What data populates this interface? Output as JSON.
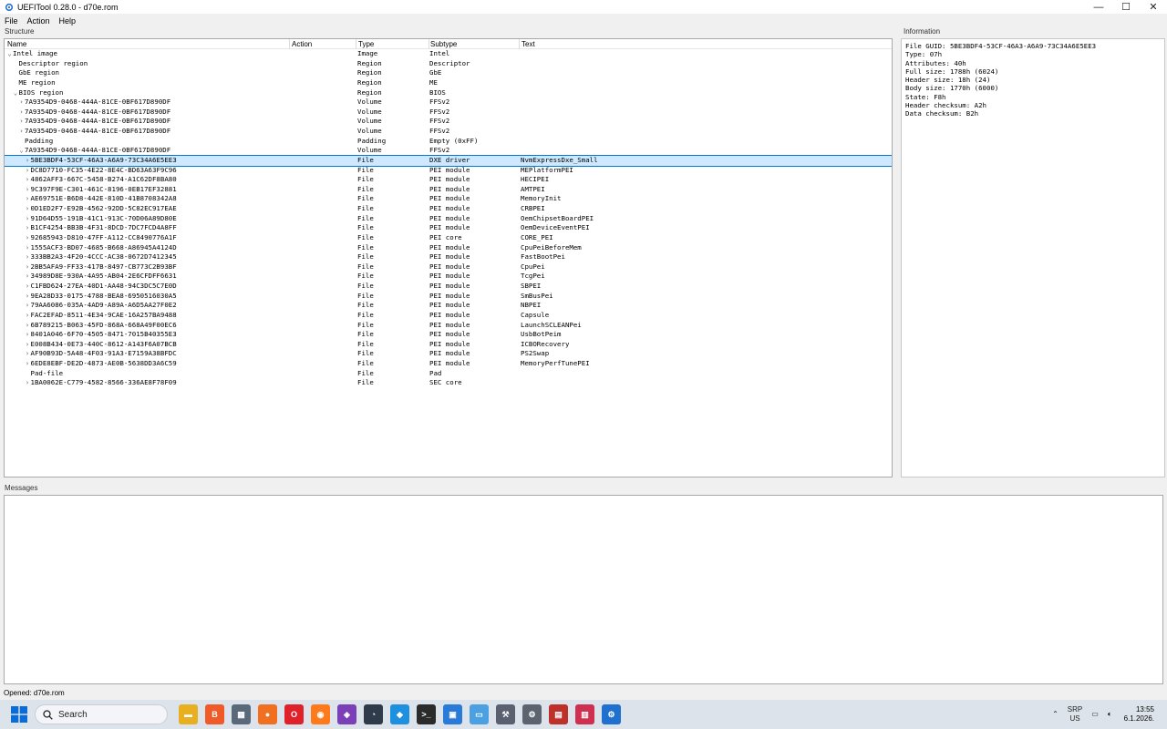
{
  "window": {
    "title": "UEFITool 0.28.0 - d70e.rom",
    "minimize_glyph": "—",
    "maximize_glyph": "☐",
    "close_glyph": "✕"
  },
  "menu": [
    "File",
    "Action",
    "Help"
  ],
  "structure": {
    "label": "Structure",
    "columns": {
      "name": "Name",
      "action": "Action",
      "type": "Type",
      "subtype": "Subtype",
      "text": "Text"
    },
    "rows": [
      {
        "indent": 0,
        "arrow": "v",
        "name": "Intel image",
        "type": "Image",
        "subtype": "Intel",
        "text": ""
      },
      {
        "indent": 1,
        "arrow": "",
        "name": "Descriptor region",
        "type": "Region",
        "subtype": "Descriptor",
        "text": ""
      },
      {
        "indent": 1,
        "arrow": "",
        "name": "GbE region",
        "type": "Region",
        "subtype": "GbE",
        "text": ""
      },
      {
        "indent": 1,
        "arrow": "",
        "name": "ME region",
        "type": "Region",
        "subtype": "ME",
        "text": ""
      },
      {
        "indent": 1,
        "arrow": "v",
        "name": "BIOS region",
        "type": "Region",
        "subtype": "BIOS",
        "text": ""
      },
      {
        "indent": 2,
        "arrow": ">",
        "name": "7A9354D9-0468-444A-81CE-0BF617D890DF",
        "type": "Volume",
        "subtype": "FFSv2",
        "text": ""
      },
      {
        "indent": 2,
        "arrow": ">",
        "name": "7A9354D9-0468-444A-81CE-0BF617D890DF",
        "type": "Volume",
        "subtype": "FFSv2",
        "text": ""
      },
      {
        "indent": 2,
        "arrow": ">",
        "name": "7A9354D9-0468-444A-81CE-0BF617D890DF",
        "type": "Volume",
        "subtype": "FFSv2",
        "text": ""
      },
      {
        "indent": 2,
        "arrow": ">",
        "name": "7A9354D9-0468-444A-81CE-0BF617D890DF",
        "type": "Volume",
        "subtype": "FFSv2",
        "text": ""
      },
      {
        "indent": 2,
        "arrow": "",
        "name": "Padding",
        "type": "Padding",
        "subtype": "Empty (0xFF)",
        "text": ""
      },
      {
        "indent": 2,
        "arrow": "v",
        "name": "7A9354D9-0468-444A-81CE-0BF617D890DF",
        "type": "Volume",
        "subtype": "FFSv2",
        "text": ""
      },
      {
        "indent": 3,
        "arrow": ">",
        "name": "5BE3BDF4-53CF-46A3-A6A9-73C34A6E5EE3",
        "type": "File",
        "subtype": "DXE driver",
        "text": "NvmExpressDxe_Small",
        "selected": true
      },
      {
        "indent": 3,
        "arrow": ">",
        "name": "DC8D7710-FC35-4E22-8E4C-BD63A63F9C96",
        "type": "File",
        "subtype": "PEI module",
        "text": "MEPlatformPEI"
      },
      {
        "indent": 3,
        "arrow": ">",
        "name": "4862AFF3-667C-5458-B274-A1C62DF8BA80",
        "type": "File",
        "subtype": "PEI module",
        "text": "HECIPEI"
      },
      {
        "indent": 3,
        "arrow": ">",
        "name": "9C397F9E-C301-461C-8196-0EB17EF32881",
        "type": "File",
        "subtype": "PEI module",
        "text": "AMTPEI"
      },
      {
        "indent": 3,
        "arrow": ">",
        "name": "AE69751E-B6D8-442E-810D-41B8708342A8",
        "type": "File",
        "subtype": "PEI module",
        "text": "MemoryInit"
      },
      {
        "indent": 3,
        "arrow": ">",
        "name": "0D1ED2F7-E92B-4562-92DD-5C82EC917EAE",
        "type": "File",
        "subtype": "PEI module",
        "text": "CRBPEI"
      },
      {
        "indent": 3,
        "arrow": ">",
        "name": "91D64D55-191B-41C1-913C-70D06A89D80E",
        "type": "File",
        "subtype": "PEI module",
        "text": "OemChipsetBoardPEI"
      },
      {
        "indent": 3,
        "arrow": ">",
        "name": "B1CF4254-BB3B-4F31-8DCD-7DC7FCD4A8FF",
        "type": "File",
        "subtype": "PEI module",
        "text": "OemDeviceEventPEI"
      },
      {
        "indent": 3,
        "arrow": ">",
        "name": "92685943-D810-47FF-A112-CC8490776A1F",
        "type": "File",
        "subtype": "PEI core",
        "text": "CORE_PEI"
      },
      {
        "indent": 3,
        "arrow": ">",
        "name": "1555ACF3-BD07-4685-B668-A86945A4124D",
        "type": "File",
        "subtype": "PEI module",
        "text": "CpuPeiBeforeMem"
      },
      {
        "indent": 3,
        "arrow": ">",
        "name": "333BB2A3-4F20-4CCC-AC38-0672D7412345",
        "type": "File",
        "subtype": "PEI module",
        "text": "FastBootPei"
      },
      {
        "indent": 3,
        "arrow": ">",
        "name": "2BB5AFA9-FF33-417B-8497-CB773C2B93BF",
        "type": "File",
        "subtype": "PEI module",
        "text": "CpuPei"
      },
      {
        "indent": 3,
        "arrow": ">",
        "name": "34989D8E-930A-4A95-AB04-2E6CFDFF6631",
        "type": "File",
        "subtype": "PEI module",
        "text": "TcgPei"
      },
      {
        "indent": 3,
        "arrow": ">",
        "name": "C1FBD624-27EA-40D1-AA48-94C3DC5C7E0D",
        "type": "File",
        "subtype": "PEI module",
        "text": "SBPEI"
      },
      {
        "indent": 3,
        "arrow": ">",
        "name": "9EA28D33-0175-4788-BEA8-6950516030A5",
        "type": "File",
        "subtype": "PEI module",
        "text": "SmBusPei"
      },
      {
        "indent": 3,
        "arrow": ">",
        "name": "79AA6086-035A-4AD9-A89A-A6D5AA27F0E2",
        "type": "File",
        "subtype": "PEI module",
        "text": "NBPEI"
      },
      {
        "indent": 3,
        "arrow": ">",
        "name": "FAC2EFAD-8511-4E34-9CAE-16A257BA9488",
        "type": "File",
        "subtype": "PEI module",
        "text": "Capsule"
      },
      {
        "indent": 3,
        "arrow": ">",
        "name": "6B789215-B063-45FD-868A-668A49F00EC6",
        "type": "File",
        "subtype": "PEI module",
        "text": "LaunchSCLEANPei"
      },
      {
        "indent": 3,
        "arrow": ">",
        "name": "8401A046-6F70-4505-8471-7015B40355E3",
        "type": "File",
        "subtype": "PEI module",
        "text": "UsbBotPeim"
      },
      {
        "indent": 3,
        "arrow": ">",
        "name": "E008B434-0E73-440C-8612-A143F6A07BCB",
        "type": "File",
        "subtype": "PEI module",
        "text": "ICBORecovery"
      },
      {
        "indent": 3,
        "arrow": ">",
        "name": "AF90B93D-5A48-4F03-91A3-E7159A38BFDC",
        "type": "File",
        "subtype": "PEI module",
        "text": "PS2Swap"
      },
      {
        "indent": 3,
        "arrow": ">",
        "name": "6EDE8EBF-DE2D-4873-AE0B-5638DD3A6C59",
        "type": "File",
        "subtype": "PEI module",
        "text": "MemoryPerfTunePEI"
      },
      {
        "indent": 3,
        "arrow": "",
        "name": "Pad-file",
        "type": "File",
        "subtype": "Pad",
        "text": ""
      },
      {
        "indent": 3,
        "arrow": ">",
        "name": "1BA0062E-C779-4582-8566-336AE8F78F09",
        "type": "File",
        "subtype": "SEC core",
        "text": ""
      }
    ]
  },
  "information": {
    "label": "Information",
    "lines": [
      "File GUID: 5BE3BDF4-53CF-46A3-A6A9-73C34A6E5EE3",
      "Type: 07h",
      "Attributes: 40h",
      "Full size: 1788h (6024)",
      "Header size: 18h (24)",
      "Body size: 1770h (6000)",
      "State: F8h",
      "Header checksum: A2h",
      "Data checksum: B2h"
    ]
  },
  "messages": {
    "label": "Messages"
  },
  "status": "Opened: d70e.rom",
  "taskbar": {
    "search_label": "Search",
    "apps": [
      {
        "icon": "file-manager-icon",
        "color": "#e8b020",
        "glyph": "▬"
      },
      {
        "icon": "brave-icon",
        "color": "#f05a28",
        "glyph": "B"
      },
      {
        "icon": "calculator-icon",
        "color": "#5a6a7a",
        "glyph": "▦"
      },
      {
        "icon": "orange-app-icon",
        "color": "#f07020",
        "glyph": "●"
      },
      {
        "icon": "opera-icon",
        "color": "#e0202a",
        "glyph": "O"
      },
      {
        "icon": "firefox-icon",
        "color": "#ff7a1a",
        "glyph": "◉"
      },
      {
        "icon": "purple-app-icon",
        "color": "#7b3fb8",
        "glyph": "◈"
      },
      {
        "icon": "speedometer-icon",
        "color": "#2f3a4a",
        "glyph": "◔"
      },
      {
        "icon": "blue-app-icon",
        "color": "#1e90e0",
        "glyph": "◆"
      },
      {
        "icon": "terminal-icon",
        "color": "#2b2b2b",
        "glyph": ">_"
      },
      {
        "icon": "store-icon",
        "color": "#2a7ad8",
        "glyph": "▣"
      },
      {
        "icon": "remote-desktop-icon",
        "color": "#4aa0e0",
        "glyph": "▭"
      },
      {
        "icon": "tool-icon",
        "color": "#5a6070",
        "glyph": "⚒"
      },
      {
        "icon": "settings-icon",
        "color": "#5d6470",
        "glyph": "⚙"
      },
      {
        "icon": "red-app-icon",
        "color": "#c0302a",
        "glyph": "▤"
      },
      {
        "icon": "chart-app-icon",
        "color": "#d03050",
        "glyph": "▥"
      },
      {
        "icon": "uefitool-icon",
        "color": "#2070d0",
        "glyph": "⚙"
      }
    ],
    "language": "SRP",
    "layout": "US",
    "time": "13:55",
    "date": "6.1.2026."
  }
}
